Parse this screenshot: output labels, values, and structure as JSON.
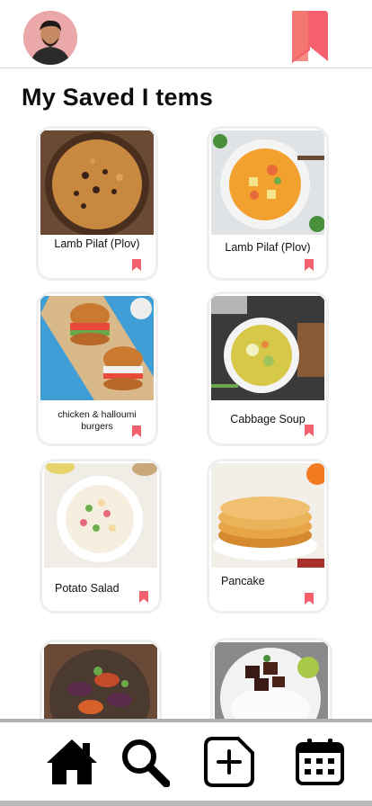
{
  "header": {
    "avatar_icon": "user-avatar",
    "bookmark_icon": "bookmark-icon",
    "bookmark_color": "#f5606e"
  },
  "page": {
    "title": "My Saved I tems"
  },
  "saved_items": [
    {
      "label": "Lamb Pilaf (Plov)",
      "image": "lamb-pilaf-photo",
      "saved": true
    },
    {
      "label": "Lamb Pilaf (Plov)",
      "image": "vegetable-soup-photo",
      "saved": true
    },
    {
      "label": "chicken & halloumi burgers",
      "image": "burgers-photo",
      "saved": true
    },
    {
      "label": "Cabbage Soup",
      "image": "cabbage-soup-photo",
      "saved": true
    },
    {
      "label": "Potato Salad",
      "image": "potato-salad-photo",
      "saved": true
    },
    {
      "label": "Pancake",
      "image": "pancake-photo",
      "saved": true
    },
    {
      "label": "",
      "image": "roasted-eggplant-photo",
      "saved": true
    },
    {
      "label": "",
      "image": "beef-rice-photo",
      "saved": true
    }
  ],
  "bottom_nav": {
    "items": [
      {
        "icon": "home-icon"
      },
      {
        "icon": "search-icon"
      },
      {
        "icon": "add-note-icon"
      },
      {
        "icon": "calendar-icon"
      }
    ]
  }
}
